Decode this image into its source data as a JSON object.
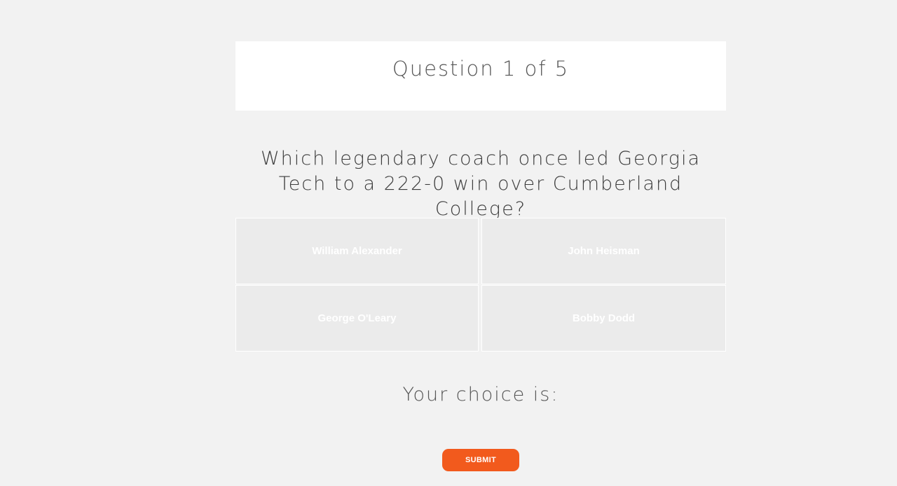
{
  "quiz": {
    "counter": "Question 1 of 5",
    "question": "Which legendary coach once led Georgia Tech to a 222-0 win over Cumberland College?",
    "options": [
      {
        "label": "William Alexander"
      },
      {
        "label": "John Heisman"
      },
      {
        "label": "George O'Leary"
      },
      {
        "label": "Bobby Dodd"
      }
    ],
    "choice_label": "Your choice is:",
    "submit_label": "SUBMIT"
  },
  "colors": {
    "background": "#f2f2f2",
    "option_background": "#ebebeb",
    "submit_accent": "#f25a1d",
    "text": "#3c3c3c"
  }
}
